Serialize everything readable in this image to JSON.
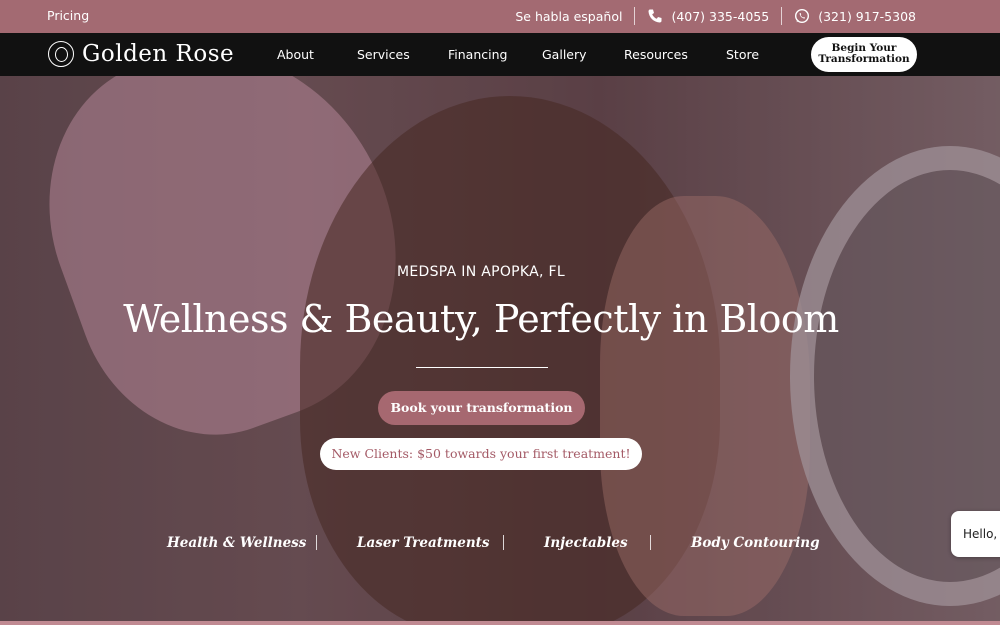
{
  "topbar": {
    "pricing": "Pricing",
    "spanish": "Se habla español",
    "phone": "(407) 335-4055",
    "whatsapp": "(321) 917-5308"
  },
  "nav": {
    "brand": "Golden Rose",
    "items": [
      "About",
      "Services",
      "Financing",
      "Gallery",
      "Resources",
      "Store"
    ],
    "cta_line1": "Begin Your",
    "cta_line2": "Transformation"
  },
  "hero": {
    "eyebrow": "MEDSPA IN APOPKA, FL",
    "headline": "Wellness & Beauty, Perfectly in Bloom",
    "book_button": "Book your transformation",
    "offer_button": "New Clients: $50 towards your first treatment!",
    "categories": [
      "Health & Wellness",
      "Laser Treatments",
      "Injectables",
      "Body Contouring"
    ]
  },
  "chat": {
    "text": "Hello, H"
  },
  "colors": {
    "topbar": "#a36a72",
    "nav": "#111111",
    "accent": "#a66870"
  },
  "icons": {
    "phone": "phone-icon",
    "whatsapp": "whatsapp-icon",
    "logo": "rose-logo-icon"
  }
}
